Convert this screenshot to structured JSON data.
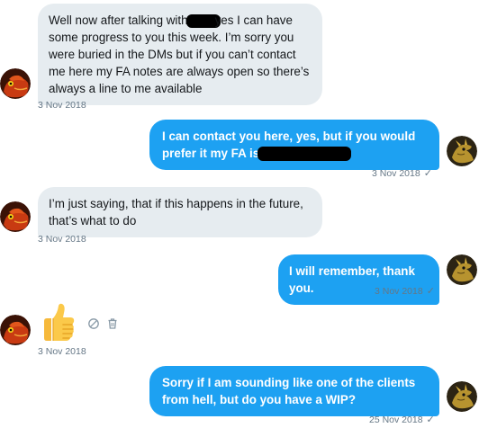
{
  "messages": [
    {
      "side": "in",
      "text_before": "Well now after talking with",
      "text_after": "yes I can have some progress to you this week. I’m sorry you were buried in the DMs but if you can’t contact me here my FA notes are always open so there’s always a line to me available",
      "time": "3 Nov 2018"
    },
    {
      "side": "out",
      "text_before": "I can contact you here, yes, but if you would prefer it my FA is",
      "time": "3 Nov 2018",
      "status": "✓"
    },
    {
      "side": "in",
      "text": "I’m just saying, that if this happens in the future, that’s what to do",
      "time": "3 Nov 2018"
    },
    {
      "side": "out",
      "text": "I will remember, thank you.",
      "time": "3 Nov 2018",
      "status": "✓"
    },
    {
      "side": "in",
      "kind": "emoji",
      "emoji": "thumbs-up",
      "time": "3 Nov 2018",
      "actions": [
        "report-icon",
        "delete-icon"
      ]
    },
    {
      "side": "out",
      "text": "Sorry if I am sounding like one of the clients from hell, but do you have a WIP?",
      "time": "25 Nov 2018",
      "status": "✓"
    }
  ],
  "colors": {
    "incoming_bubble": "#e6ecf0",
    "outgoing_bubble": "#1da1f2",
    "meta_text": "#657786"
  },
  "avatars": {
    "other": "red-lizard-avatar",
    "self": "golden-creature-avatar"
  }
}
